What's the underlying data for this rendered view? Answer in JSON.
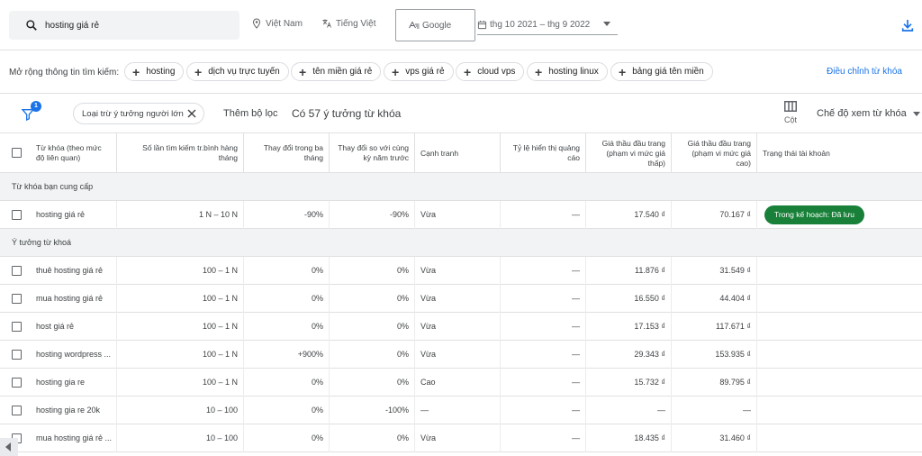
{
  "search": {
    "value": "hosting giá rẻ"
  },
  "top": {
    "location": "Việt Nam",
    "language": "Tiếng Việt",
    "network": "Google",
    "date_range": "thg 10 2021 – thg 9 2022"
  },
  "expand": {
    "label": "Mở rộng thông tin tìm kiếm:",
    "chips": [
      "hosting",
      "dịch vụ trực tuyến",
      "tên miền giá rẻ",
      "vps giá rẻ",
      "cloud vps",
      "hosting linux",
      "bảng giá tên miền"
    ],
    "adjust_link": "Điều chỉnh từ khóa"
  },
  "filters": {
    "badge": "1",
    "exclude_chip": "Loại trừ ý tưởng người lớn",
    "add_filter": "Thêm bộ lọc",
    "count_text": "Có 57 ý tưởng từ khóa",
    "columns_label": "Cột",
    "view_mode": "Chế độ xem từ khóa"
  },
  "table": {
    "headers": {
      "keyword": "Từ khóa (theo mức độ liên quan)",
      "monthly": "Số lần tìm kiếm tr.bình hàng tháng",
      "three_month": "Thay đổi trong ba tháng",
      "yoy": "Thay đổi so với cùng kỳ năm trước",
      "competition": "Cạnh tranh",
      "impression_share": "Tỷ lệ hiển thị quảng cáo",
      "bid_low": "Giá thầu đầu trang (phạm vi mức giá thấp)",
      "bid_high": "Giá thầu đầu trang (phạm vi mức giá cao)",
      "account_status": "Trạng thái tài khoản"
    },
    "provided_section": "Từ khóa bạn cung cấp",
    "provided": [
      {
        "keyword": "hosting giá rẻ",
        "monthly": "1 N – 10 N",
        "three_month": "-90%",
        "yoy": "-90%",
        "competition": "Vừa",
        "impression": "—",
        "bid_low": "17.540 ₫",
        "bid_high": "70.167 ₫",
        "status": "Trong kế hoạch: Đã lưu"
      }
    ],
    "ideas_section": "Ý tưởng từ khoá",
    "ideas": [
      {
        "keyword": "thuê hosting giá rẻ",
        "monthly": "100 – 1 N",
        "three_month": "0%",
        "yoy": "0%",
        "competition": "Vừa",
        "impression": "—",
        "bid_low": "11.876 ₫",
        "bid_high": "31.549 ₫"
      },
      {
        "keyword": "mua hosting giá rẻ",
        "monthly": "100 – 1 N",
        "three_month": "0%",
        "yoy": "0%",
        "competition": "Vừa",
        "impression": "—",
        "bid_low": "16.550 ₫",
        "bid_high": "44.404 ₫"
      },
      {
        "keyword": "host giá rẻ",
        "monthly": "100 – 1 N",
        "three_month": "0%",
        "yoy": "0%",
        "competition": "Vừa",
        "impression": "—",
        "bid_low": "17.153 ₫",
        "bid_high": "117.671 ₫"
      },
      {
        "keyword": "hosting wordpress ...",
        "monthly": "100 – 1 N",
        "three_month": "+900%",
        "yoy": "0%",
        "competition": "Vừa",
        "impression": "—",
        "bid_low": "29.343 ₫",
        "bid_high": "153.935 ₫"
      },
      {
        "keyword": "hosting gia re",
        "monthly": "100 – 1 N",
        "three_month": "0%",
        "yoy": "0%",
        "competition": "Cao",
        "impression": "—",
        "bid_low": "15.732 ₫",
        "bid_high": "89.795 ₫"
      },
      {
        "keyword": "hosting gia re 20k",
        "monthly": "10 – 100",
        "three_month": "0%",
        "yoy": "-100%",
        "competition": "—",
        "impression": "—",
        "bid_low": "—",
        "bid_high": "—"
      },
      {
        "keyword": "mua hosting giá rẻ ...",
        "monthly": "10 – 100",
        "three_month": "0%",
        "yoy": "0%",
        "competition": "Vừa",
        "impression": "—",
        "bid_low": "18.435 ₫",
        "bid_high": "31.460 ₫"
      }
    ]
  },
  "colors": {
    "accent": "#1a73e8",
    "status_green": "#188038"
  }
}
